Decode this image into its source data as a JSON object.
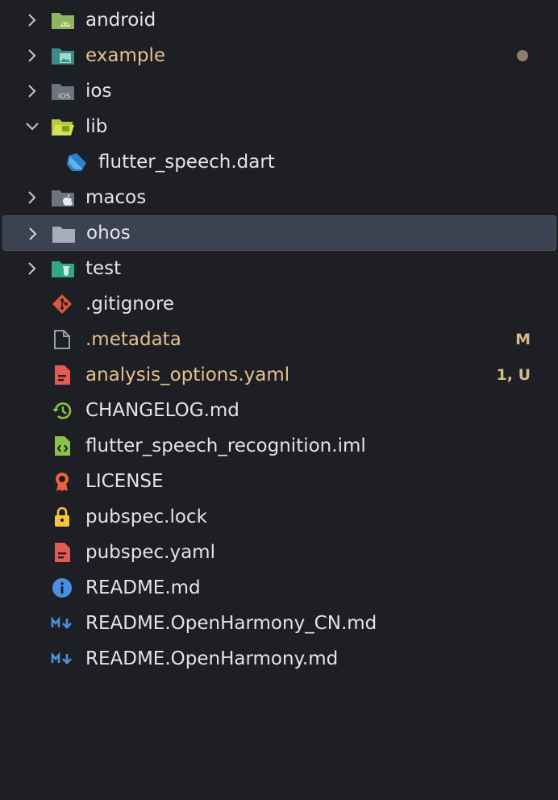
{
  "explorer": {
    "items": [
      {
        "label": "android",
        "icon": "android-folder-icon",
        "kind": "folder",
        "expanded": false,
        "status": ""
      },
      {
        "label": "example",
        "icon": "image-folder-icon",
        "kind": "folder",
        "expanded": false,
        "status": "dot",
        "modified": true
      },
      {
        "label": "ios",
        "icon": "ios-folder-icon",
        "kind": "folder",
        "expanded": false,
        "status": ""
      },
      {
        "label": "lib",
        "icon": "lib-folder-open-icon",
        "kind": "folder",
        "expanded": true,
        "status": ""
      },
      {
        "label": "flutter_speech.dart",
        "icon": "dart-file-icon",
        "kind": "file",
        "indent": 1,
        "status": ""
      },
      {
        "label": "macos",
        "icon": "apple-folder-icon",
        "kind": "folder",
        "expanded": false,
        "status": ""
      },
      {
        "label": "ohos",
        "icon": "folder-icon",
        "kind": "folder",
        "expanded": false,
        "status": "",
        "selected": true
      },
      {
        "label": "test",
        "icon": "test-folder-icon",
        "kind": "folder",
        "expanded": false,
        "status": ""
      },
      {
        "label": ".gitignore",
        "icon": "git-icon",
        "kind": "file",
        "status": ""
      },
      {
        "label": ".metadata",
        "icon": "file-icon",
        "kind": "file",
        "status": "M",
        "modified": true
      },
      {
        "label": "analysis_options.yaml",
        "icon": "yaml-file-icon",
        "kind": "file",
        "status": "1, U",
        "modified": true
      },
      {
        "label": "CHANGELOG.md",
        "icon": "history-icon",
        "kind": "file",
        "status": ""
      },
      {
        "label": "flutter_speech_recognition.iml",
        "icon": "iml-file-icon",
        "kind": "file",
        "status": ""
      },
      {
        "label": "LICENSE",
        "icon": "license-icon",
        "kind": "file",
        "status": ""
      },
      {
        "label": "pubspec.lock",
        "icon": "lock-icon",
        "kind": "file",
        "status": ""
      },
      {
        "label": "pubspec.yaml",
        "icon": "yaml-file-icon",
        "kind": "file",
        "status": ""
      },
      {
        "label": "README.md",
        "icon": "info-icon",
        "kind": "file",
        "status": ""
      },
      {
        "label": "README.OpenHarmony_CN.md",
        "icon": "markdown-icon",
        "kind": "file",
        "status": ""
      },
      {
        "label": "README.OpenHarmony.md",
        "icon": "markdown-icon",
        "kind": "file",
        "status": ""
      }
    ],
    "colors": {
      "background": "#1e1f24",
      "selected_row": "#3b4252",
      "modified_text": "#e4c18f",
      "status_text": "#d9b88c"
    }
  }
}
